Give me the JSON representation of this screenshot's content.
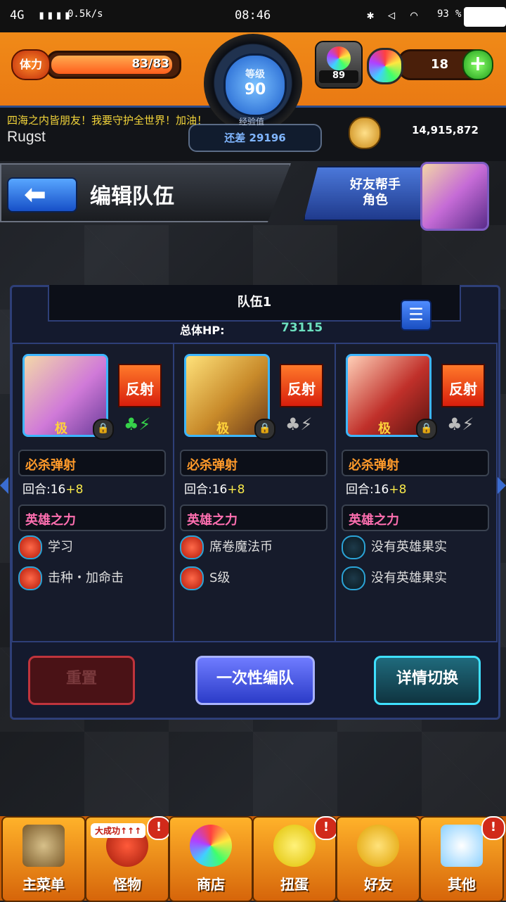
{
  "status_bar": {
    "network": "4G",
    "speed": "0.5k/s",
    "time": "08:46",
    "battery": "93"
  },
  "header": {
    "stamina_label": "体力",
    "stamina_value": "83/83",
    "stamina_fraction": 1.0,
    "level_label": "等级",
    "level_value": "90",
    "exp_label": "经验值",
    "exp_remaining": "还差 29196",
    "gem_count": "89",
    "orb_count": "18",
    "motto": "四海之内皆朋友！我要守护全世界！加油！",
    "username": "Rugst",
    "gold": "14,915,872"
  },
  "title_bar": {
    "title": "编辑队伍",
    "friend_helper": "好友帮手\n角色"
  },
  "team": {
    "name": "队伍1",
    "hp_label": "总体HP:",
    "hp_value": "73115"
  },
  "slots": [
    {
      "tag": "反射",
      "skill": "必杀弹射",
      "turns": "回合:16",
      "turns_bonus": "+8",
      "power": "英雄之力",
      "fruit1": "学习",
      "fruit2": "击种・加命击",
      "grade": "极"
    },
    {
      "tag": "反射",
      "skill": "必杀弹射",
      "turns": "回合:16",
      "turns_bonus": "+8",
      "power": "英雄之力",
      "fruit1": "席卷魔法币",
      "fruit2": "S级",
      "grade": "极"
    },
    {
      "tag": "反射",
      "skill": "必杀弹射",
      "turns": "回合:16",
      "turns_bonus": "+8",
      "power": "英雄之力",
      "fruit1": "没有英雄果实",
      "fruit2": "没有英雄果实",
      "grade": "极"
    }
  ],
  "buttons": {
    "reset": "重置",
    "one_time": "一次性编队",
    "detail": "详情切换"
  },
  "nav": [
    {
      "label": "主菜单"
    },
    {
      "label": "怪物",
      "tag": "大成功↑↑↑",
      "alert": "!"
    },
    {
      "label": "商店"
    },
    {
      "label": "扭蛋",
      "alert": "!"
    },
    {
      "label": "好友"
    },
    {
      "label": "其他",
      "alert": "!"
    }
  ],
  "colors": {
    "header_orange": "#f08a18",
    "panel_border": "#2e3f78",
    "hp_teal": "#6de0c0",
    "skill_orange": "#ff9a2a",
    "power_pink": "#ff6fb0"
  }
}
